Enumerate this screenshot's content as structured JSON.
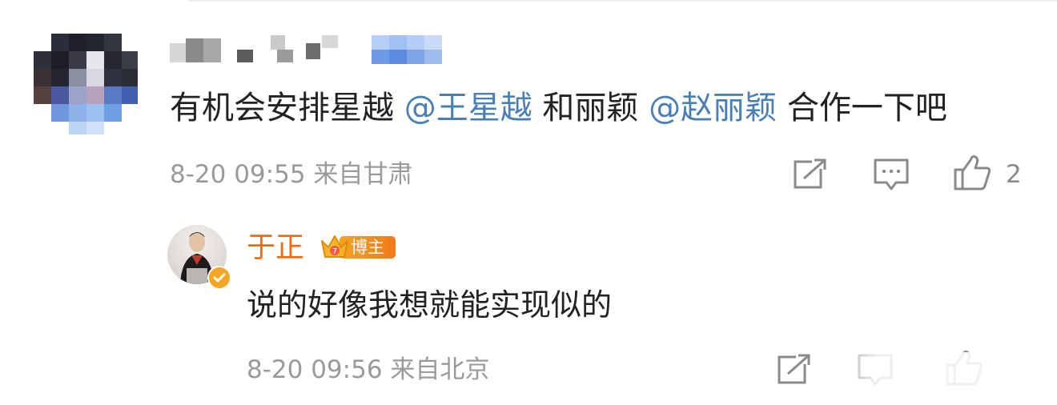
{
  "comment": {
    "text_parts": [
      {
        "text": "有机会安排星越 ",
        "mention": false
      },
      {
        "text": "@王星越",
        "mention": true
      },
      {
        "text": " 和丽颖 ",
        "mention": false
      },
      {
        "text": "@赵丽颖",
        "mention": true
      },
      {
        "text": " 合作一下吧",
        "mention": false
      }
    ],
    "meta": "8-20 09:55 来自甘肃",
    "like_count": "2"
  },
  "reply": {
    "username": "于正",
    "badge_label": "博主",
    "text": "说的好像我想就能实现似的",
    "meta": "8-20 09:56 来自北京"
  },
  "colors": {
    "mention": "#4a7fb5",
    "reply_name": "#f06a0f",
    "meta_text": "#9a9a9a",
    "badge": "#f3a51f"
  },
  "icons": [
    "share-icon",
    "comment-icon",
    "like-icon",
    "crown-icon",
    "verified-icon"
  ]
}
